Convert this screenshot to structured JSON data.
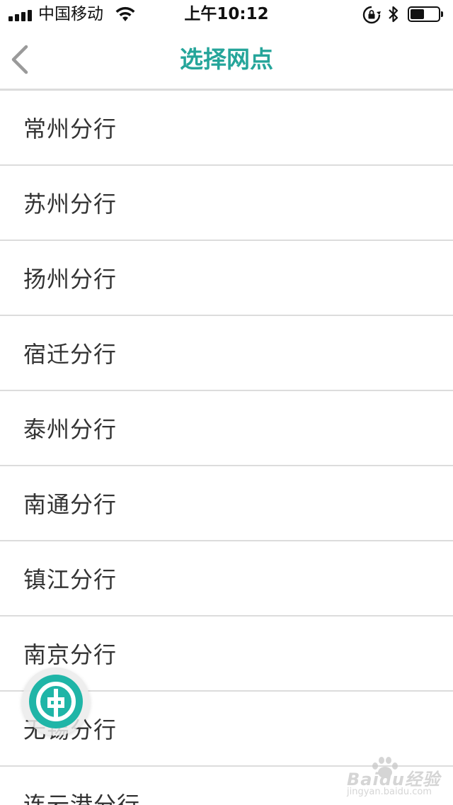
{
  "status_bar": {
    "carrier": "中国移动",
    "time": "上午10:12",
    "battery_level": 0.5,
    "icons": [
      "signal-icon",
      "wifi-icon",
      "rotation-lock-icon",
      "bluetooth-icon",
      "battery-icon"
    ]
  },
  "nav": {
    "title": "选择网点",
    "back_icon": "chevron-left-icon"
  },
  "branches": [
    {
      "label": "常州分行"
    },
    {
      "label": "苏州分行"
    },
    {
      "label": "扬州分行"
    },
    {
      "label": "宿迁分行"
    },
    {
      "label": "泰州分行"
    },
    {
      "label": "南通分行"
    },
    {
      "label": "镇江分行"
    },
    {
      "label": "南京分行"
    },
    {
      "label": "无锡分行"
    },
    {
      "label": "连云港分行"
    }
  ],
  "float_button": {
    "icon": "bank-logo-icon"
  },
  "watermark": {
    "brand": "Baidu经验",
    "url": "jingyan.baidu.com"
  },
  "colors": {
    "accent": "#25a59a",
    "text": "#333333",
    "divider": "#dcdcdc"
  }
}
